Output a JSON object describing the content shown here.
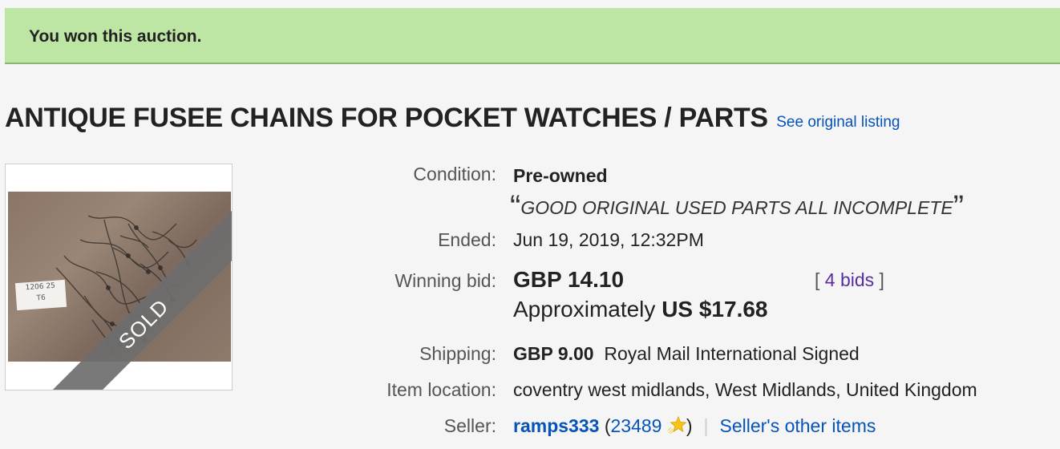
{
  "banner": {
    "message": "You won this auction."
  },
  "listing": {
    "title": "ANTIQUE FUSEE CHAINS FOR POCKET WATCHES / PARTS",
    "see_original": "See original listing"
  },
  "image": {
    "tag_line1": "1206 25",
    "tag_line2": "T6",
    "sold_label": "SOLD"
  },
  "details": {
    "condition_label": "Condition:",
    "condition_value": "Pre-owned",
    "condition_note": "GOOD ORIGINAL USED PARTS ALL INCOMPLETE",
    "open_quote": "“",
    "close_quote": "”",
    "ended_label": "Ended:",
    "ended_date": "Jun 19, 2019",
    "ended_sep": ",",
    "ended_time": "12:32PM",
    "winning_bid_label": "Winning bid:",
    "winning_bid_value": "GBP 14.10",
    "bids_open": "[",
    "bids_count": "4 bids",
    "bids_close": "]",
    "approx_prefix": "Approximately",
    "approx_value": "US $17.68",
    "shipping_label": "Shipping:",
    "shipping_cost": "GBP 9.00",
    "shipping_service": "Royal Mail International Signed",
    "location_label": "Item location:",
    "location_value": "coventry west midlands, West Midlands, United Kingdom",
    "seller_label": "Seller:",
    "seller_name": "ramps333",
    "feedback_open": "(",
    "feedback_score": "23489",
    "feedback_close": ")",
    "separator": "|",
    "other_items": "Seller's other items"
  },
  "colors": {
    "banner_bg": "#bde5a4",
    "link_blue": "#0654ba",
    "bids_purple": "#5a2da0",
    "star_yellow": "#f7c21b"
  },
  "icons": {
    "feedback_star": "shooting-star-icon"
  }
}
